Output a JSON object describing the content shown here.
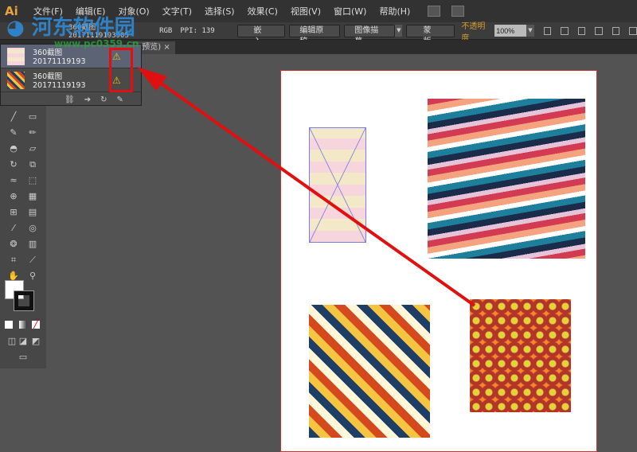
{
  "app": {
    "logo": "Ai"
  },
  "menu": [
    "文件(F)",
    "编辑(E)",
    "对象(O)",
    "文字(T)",
    "选择(S)",
    "效果(C)",
    "视图(V)",
    "窗口(W)",
    "帮助(H)"
  ],
  "control": {
    "filename": "360截图20171119193905",
    "color_mode": "RGB",
    "ppi": "PPI: 139",
    "embed": "嵌入",
    "edit_original": "编辑原稿",
    "image_trace": "图像描摹",
    "mask": "蒙版",
    "opacity_label": "不透明度",
    "opacity_value": "100%"
  },
  "document_tab": {
    "label": "(/预览)",
    "close": "×"
  },
  "links_panel": {
    "items": [
      {
        "name": "360截图20171119193",
        "status": "warning"
      },
      {
        "name": "360截图20171119193",
        "status": "warning"
      }
    ]
  },
  "watermark": {
    "logo": "河东软件园",
    "url": "www.pc0359.cn"
  },
  "colors": {
    "accent": "#e01010",
    "warning": "#f2c200",
    "opacity_label": "#d89a2a"
  }
}
